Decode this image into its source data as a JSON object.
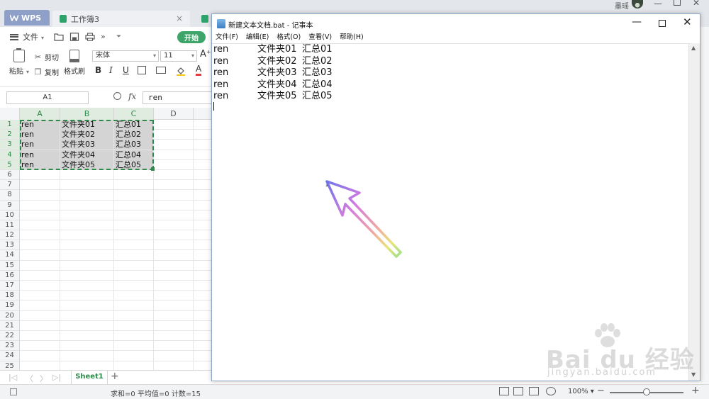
{
  "wps": {
    "tabs": [
      {
        "label": "WPS"
      },
      {
        "label": "工作簿3"
      }
    ],
    "user_name": "墨瑶",
    "menu": {
      "file_label": "文件",
      "start_label": "开始"
    },
    "ribbon": {
      "paste_label": "粘贴",
      "cut_label": "剪切",
      "copy_label": "复制",
      "format_painter_label": "格式刷",
      "font_name": "宋体",
      "font_size": "11",
      "bold_label": "B",
      "italic_label": "I",
      "underline_label": "U",
      "font_color_label": "A",
      "grow_font_label": "A⁺"
    },
    "formula_bar": {
      "name_box": "A1",
      "fx_label": "fx",
      "value": "ren"
    },
    "grid": {
      "columns": [
        "A",
        "B",
        "C",
        "D"
      ],
      "rows": [
        "1",
        "2",
        "3",
        "4",
        "5",
        "6",
        "7",
        "8",
        "9",
        "10",
        "11",
        "12",
        "13",
        "14",
        "15",
        "16",
        "17",
        "18",
        "19",
        "20",
        "21",
        "22",
        "23",
        "24",
        "25"
      ],
      "data": [
        [
          "ren",
          "文件夹01",
          "汇总01"
        ],
        [
          "ren",
          "文件夹02",
          "汇总02"
        ],
        [
          "ren",
          "文件夹03",
          "汇总03"
        ],
        [
          "ren",
          "文件夹04",
          "汇总04"
        ],
        [
          "ren",
          "文件夹05",
          "汇总05"
        ]
      ]
    },
    "sheet_tab": "Sheet1",
    "add_sheet": "+",
    "status": {
      "text": "求和=0  平均值=0  计数=15",
      "zoom": "100%",
      "zoom_fraction": 0.5
    },
    "colors": {
      "accent_green": "#3ea56a",
      "selection_dash": "#2e8a4a"
    }
  },
  "notepad": {
    "title": "新建文本文档.bat - 记事本",
    "menu": [
      "文件(F)",
      "编辑(E)",
      "格式(O)",
      "查看(V)",
      "帮助(H)"
    ],
    "lines": [
      [
        "ren",
        "文件夹01",
        "汇总01"
      ],
      [
        "ren",
        "文件夹02",
        "汇总02"
      ],
      [
        "ren",
        "文件夹03",
        "汇总03"
      ],
      [
        "ren",
        "文件夹04",
        "汇总04"
      ],
      [
        "ren",
        "文件夹05",
        "汇总05"
      ]
    ]
  },
  "watermark": {
    "text": "Bai du 经验",
    "sub": "jingyan.baidu.com"
  }
}
